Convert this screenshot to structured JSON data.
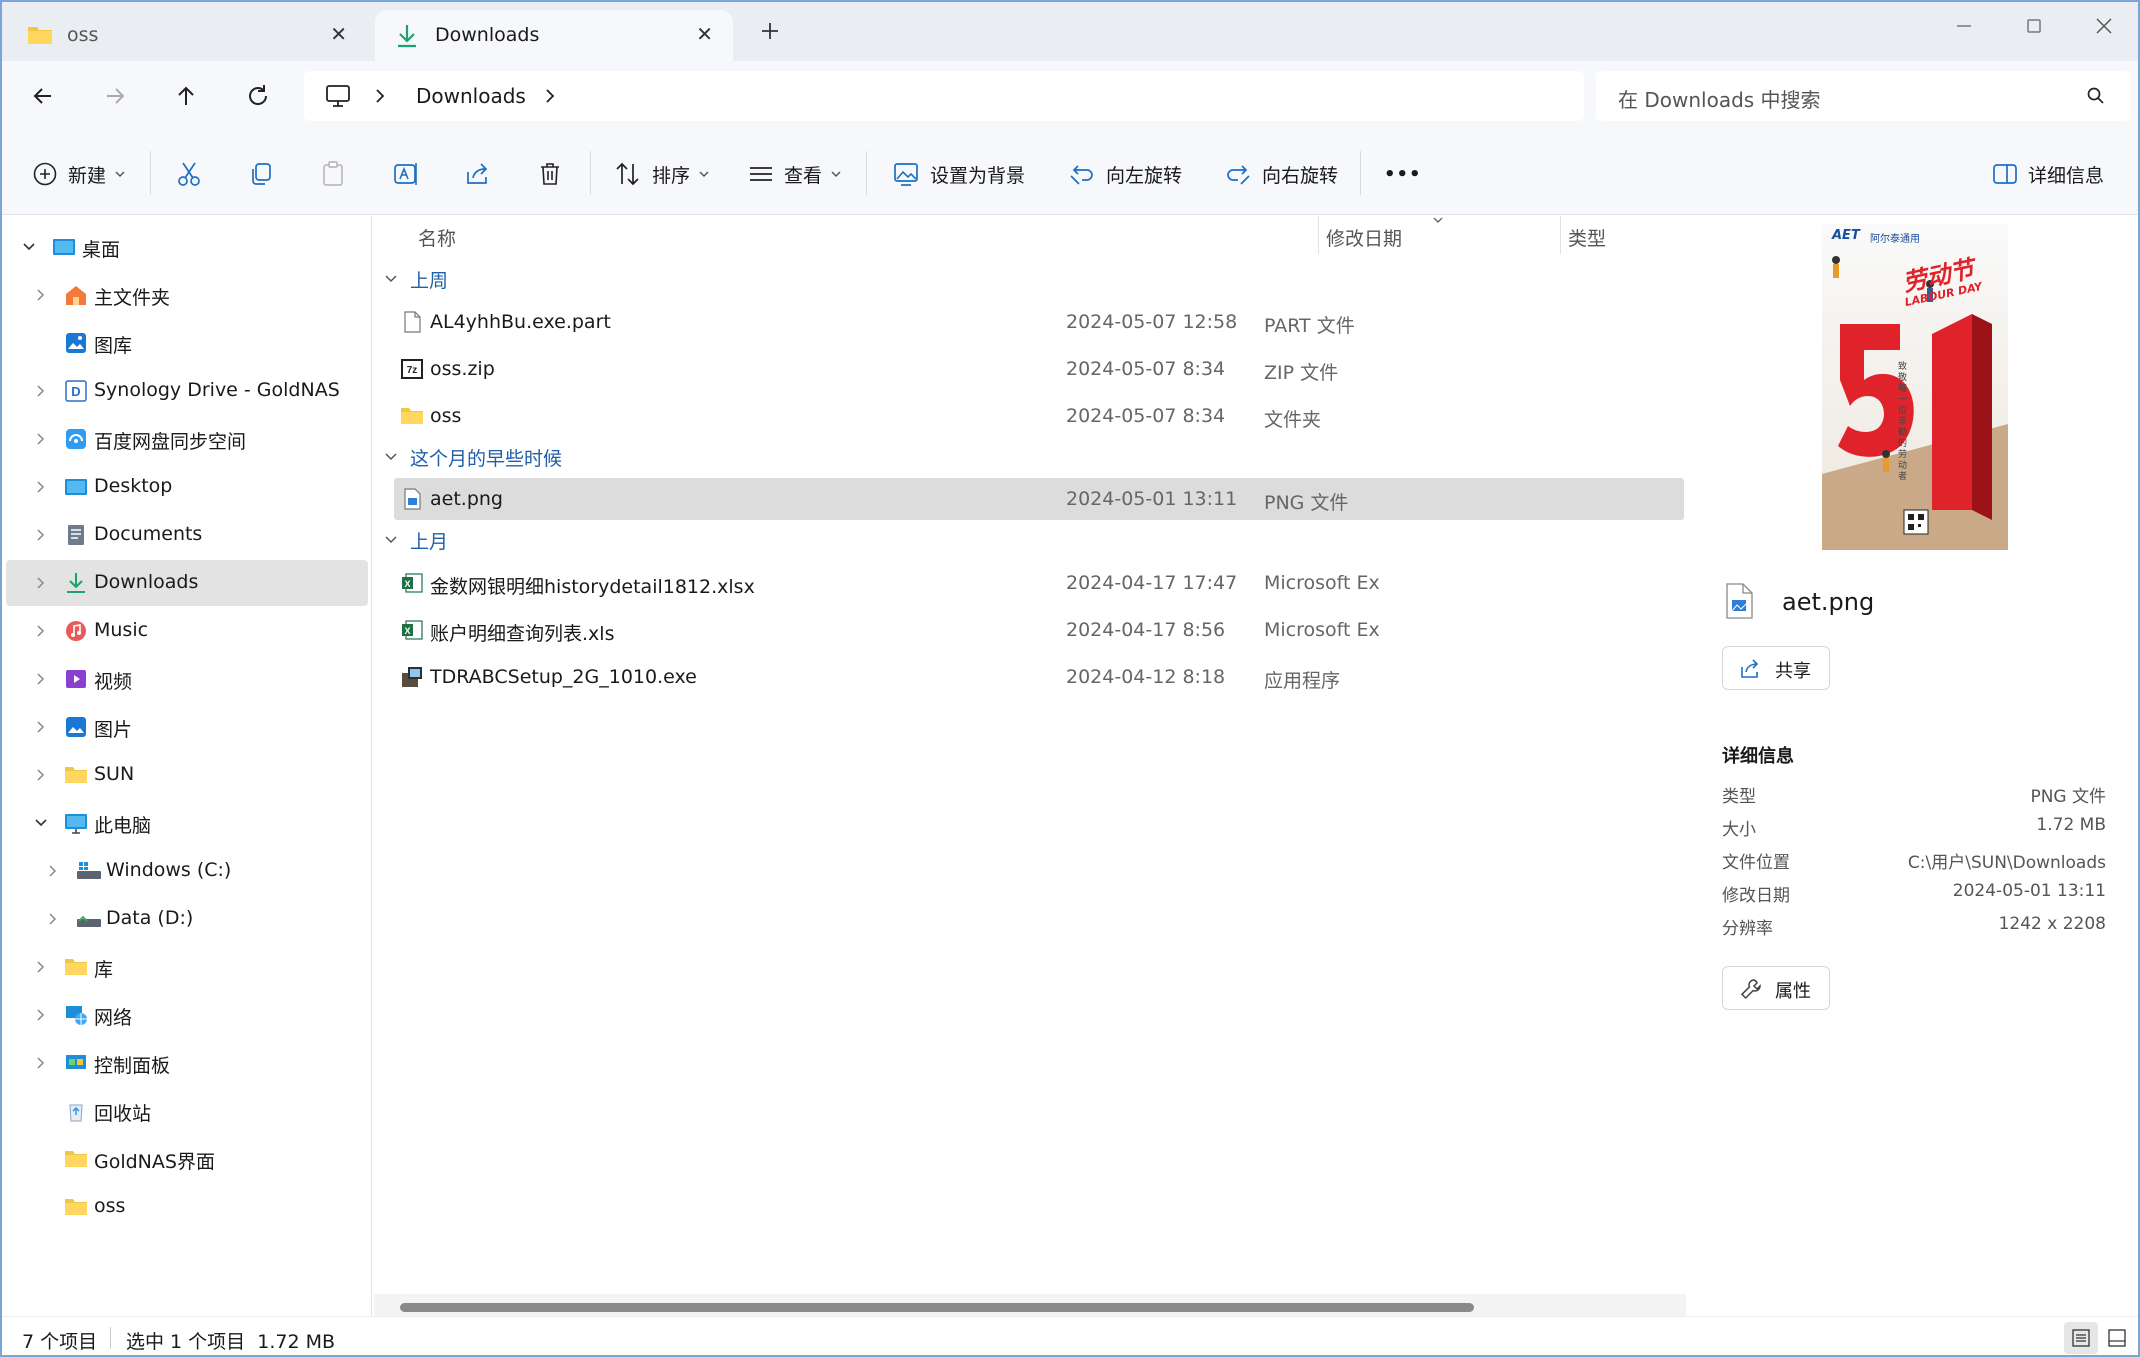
{
  "tabs": [
    {
      "label": "oss",
      "icon": "folder-icon",
      "active": false
    },
    {
      "label": "Downloads",
      "icon": "download-arrow-icon",
      "active": true
    }
  ],
  "address": {
    "segment": "Downloads",
    "search_placeholder": "在 Downloads 中搜索"
  },
  "toolbar": {
    "new_label": "新建",
    "sort_label": "排序",
    "view_label": "查看",
    "set_background_label": "设置为背景",
    "rotate_left_label": "向左旋转",
    "rotate_right_label": "向右旋转",
    "more_label": "•••",
    "details_label": "详细信息"
  },
  "sidebar": {
    "items": [
      {
        "label": "桌面",
        "icon": "desktop-icon"
      },
      {
        "label": "主文件夹",
        "icon": "home-icon"
      },
      {
        "label": "图库",
        "icon": "gallery-icon"
      },
      {
        "label": "Synology Drive - GoldNAS",
        "icon": "synology-icon"
      },
      {
        "label": "百度网盘同步空间",
        "icon": "baidu-icon"
      },
      {
        "label": "Desktop",
        "icon": "desktop-icon"
      },
      {
        "label": "Documents",
        "icon": "documents-icon"
      },
      {
        "label": "Downloads",
        "icon": "downloads-icon"
      },
      {
        "label": "Music",
        "icon": "music-icon"
      },
      {
        "label": "视频",
        "icon": "video-icon"
      },
      {
        "label": "图片",
        "icon": "pictures-icon"
      },
      {
        "label": "SUN",
        "icon": "folder-icon"
      },
      {
        "label": "此电脑",
        "icon": "this-pc-icon"
      },
      {
        "label": "Windows (C:)",
        "icon": "drive-icon"
      },
      {
        "label": "Data (D:)",
        "icon": "drive-icon"
      },
      {
        "label": "库",
        "icon": "library-icon"
      },
      {
        "label": "网络",
        "icon": "network-icon"
      },
      {
        "label": "控制面板",
        "icon": "control-panel-icon"
      },
      {
        "label": "回收站",
        "icon": "recycle-bin-icon"
      },
      {
        "label": "GoldNAS界面",
        "icon": "folder-icon"
      },
      {
        "label": "oss",
        "icon": "folder-icon"
      }
    ]
  },
  "columns": {
    "name": "名称",
    "date": "修改日期",
    "type": "类型"
  },
  "groups": [
    {
      "label": "上周",
      "files": [
        {
          "name": "AL4yhhBu.exe.part",
          "date": "2024-05-07 12:58",
          "type": "PART 文件",
          "icon": "blank-file-icon"
        },
        {
          "name": "oss.zip",
          "date": "2024-05-07 8:34",
          "type": "ZIP 文件",
          "icon": "7zip-icon"
        },
        {
          "name": "oss",
          "date": "2024-05-07 8:34",
          "type": "文件夹",
          "icon": "folder-icon"
        }
      ]
    },
    {
      "label": "这个月的早些时候",
      "files": [
        {
          "name": "aet.png",
          "date": "2024-05-01 13:11",
          "type": "PNG 文件",
          "icon": "image-file-icon"
        }
      ]
    },
    {
      "label": "上月",
      "files": [
        {
          "name": "金数网银明细historydetail1812.xlsx",
          "date": "2024-04-17 17:47",
          "type": "Microsoft Excel",
          "icon": "excel-icon"
        },
        {
          "name": "账户明细查询列表.xls",
          "date": "2024-04-17 8:56",
          "type": "Microsoft Excel",
          "icon": "excel-icon"
        },
        {
          "name": "TDRABCSetup_2G_1010.exe",
          "date": "2024-04-12 8:18",
          "type": "应用程序",
          "icon": "installer-icon"
        }
      ]
    }
  ],
  "details": {
    "filename": "aet.png",
    "share_label": "共享",
    "section_title": "详细信息",
    "properties": [
      {
        "label": "类型",
        "value": "PNG 文件"
      },
      {
        "label": "大小",
        "value": "1.72 MB"
      },
      {
        "label": "文件位置",
        "value": "C:\\用户\\SUN\\Downloads"
      },
      {
        "label": "修改日期",
        "value": "2024-05-01 13:11"
      },
      {
        "label": "分辨率",
        "value": "1242 x 2208"
      }
    ],
    "properties_label": "属性",
    "preview": {
      "brand": "AET",
      "brand_sub": "阿尔泰通用",
      "headline": "劳动节",
      "subline": "LABOUR DAY",
      "big_number": "51",
      "side_text": "致敬每一位辛勤的劳动者"
    }
  },
  "status": {
    "count": "7 个项目",
    "selection": "选中 1 个项目  1.72 MB"
  },
  "colors": {
    "accent": "#0067c0",
    "group_text": "#1f5fa8",
    "selected_row": "#dcdcdc"
  }
}
